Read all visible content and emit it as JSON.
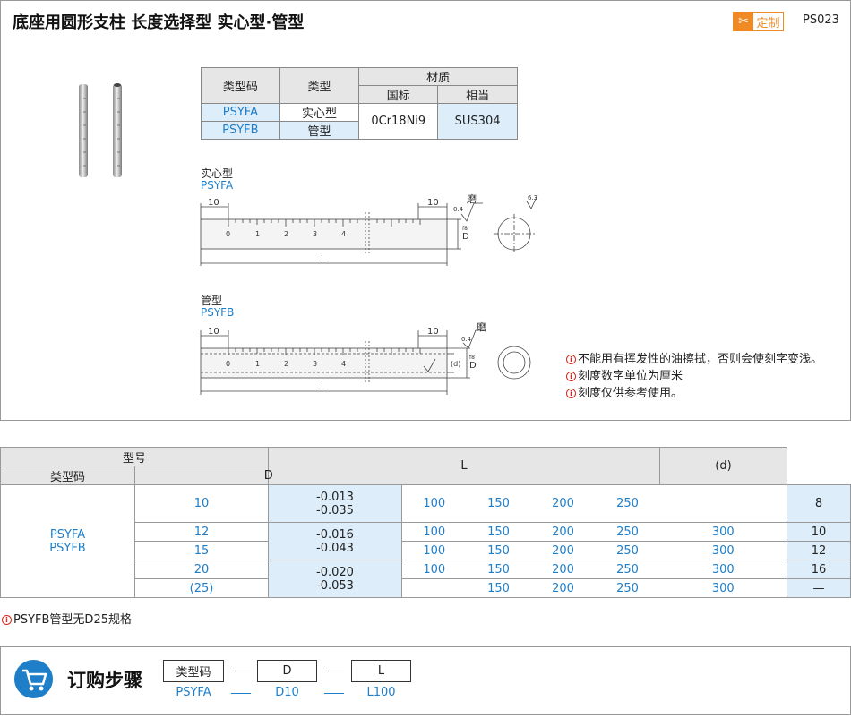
{
  "header": {
    "title": "底座用圆形支柱  长度选择型  实心型·管型",
    "custom_badge": "定制",
    "code": "PS023"
  },
  "material_table": {
    "col_type_code": "类型码",
    "col_type": "类型",
    "col_material": "材质",
    "col_gb": "国标",
    "col_equiv": "相当",
    "rows": [
      {
        "code": "PSYFA",
        "type": "实心型"
      },
      {
        "code": "PSYFB",
        "type": "管型"
      }
    ],
    "material_gb": "0Cr18Ni9",
    "material_equiv": "SUS304"
  },
  "drawing_solid": {
    "label": "实心型",
    "code": "PSYFA",
    "dim_left": "10",
    "dim_right": "10",
    "grind": "磨",
    "tol_0_4": "0.4",
    "tol_6_3": "6.3",
    "d_label": "D",
    "d_tol": "f8",
    "length_label": "L",
    "scale": [
      "0",
      "1",
      "2",
      "3",
      "4"
    ]
  },
  "drawing_tube": {
    "label": "管型",
    "code": "PSYFB",
    "dim_left": "10",
    "dim_right": "10",
    "grind": "磨",
    "tol_0_4": "0.4",
    "inner_label": "(d)",
    "d_label": "D",
    "d_tol": "f8",
    "length_label": "L",
    "scale": [
      "0",
      "1",
      "2",
      "3",
      "4"
    ]
  },
  "notes": [
    "不能用有挥发性的油擦拭，否则会使刻字变浅。",
    "刻度数字单位为厘米",
    "刻度仅供参考使用。"
  ],
  "spec_table": {
    "h_model": "型号",
    "h_type_code": "类型码",
    "h_d": "D",
    "h_l": "L",
    "h_inner": "(d)",
    "codes": [
      "PSYFA",
      "PSYFB"
    ],
    "rows": [
      {
        "d": "10",
        "l": [
          "100",
          "150",
          "200",
          "250",
          ""
        ],
        "inner": "8"
      },
      {
        "d": "12",
        "l": [
          "100",
          "150",
          "200",
          "250",
          "300"
        ],
        "inner": "10"
      },
      {
        "d": "15",
        "l": [
          "100",
          "150",
          "200",
          "250",
          "300"
        ],
        "inner": "12"
      },
      {
        "d": "20",
        "l": [
          "100",
          "150",
          "200",
          "250",
          "300"
        ],
        "inner": "16"
      },
      {
        "d": "(25)",
        "l": [
          "",
          "150",
          "200",
          "250",
          "300"
        ],
        "inner": "—"
      }
    ],
    "tolerances": [
      {
        "upper": "-0.013",
        "lower": "-0.035"
      },
      {
        "upper": "-0.016",
        "lower": "-0.043"
      },
      {
        "upper": "-0.020",
        "lower": "-0.053"
      }
    ]
  },
  "footnote": "PSYFB管型无D25规格",
  "order": {
    "title": "订购步骤",
    "boxes": [
      "类型码",
      "D",
      "L"
    ],
    "example": [
      "PSYFA",
      "D10",
      "L100"
    ]
  },
  "colors": {
    "accent": "#1e7ec8",
    "badge": "#f08a24",
    "highlight": "#ddeefa",
    "header_bg": "#e6e6e6"
  }
}
